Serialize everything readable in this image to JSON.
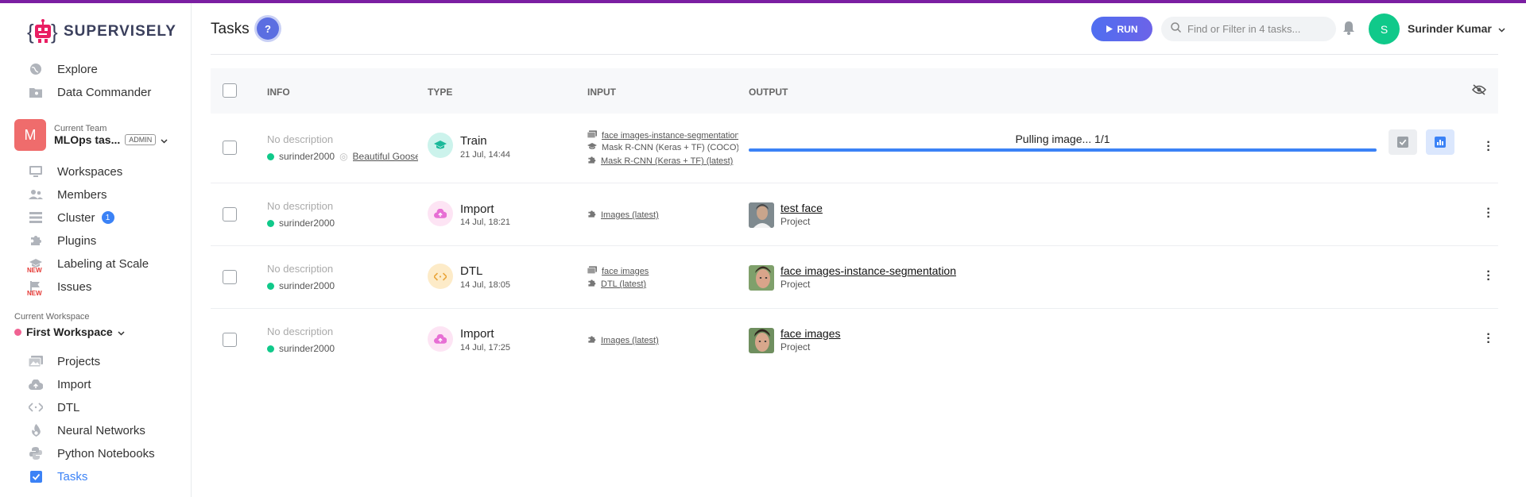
{
  "app": {
    "logo_text": "SUPERVISELY",
    "accent": "#7b1fa2"
  },
  "sidebar": {
    "top_items": [
      {
        "label": "Explore",
        "icon": "globe-icon"
      },
      {
        "label": "Data Commander",
        "icon": "folder-icon"
      }
    ],
    "team": {
      "section_label": "Current Team",
      "avatar_letter": "M",
      "name": "MLOps tas...",
      "role": "ADMIN"
    },
    "team_items": [
      {
        "label": "Workspaces",
        "icon": "monitor-icon"
      },
      {
        "label": "Members",
        "icon": "members-icon"
      },
      {
        "label": "Cluster",
        "icon": "cluster-icon",
        "badge": "1"
      },
      {
        "label": "Plugins",
        "icon": "puzzle-icon"
      },
      {
        "label": "Labeling at Scale",
        "icon": "graduation-cap-icon",
        "new": "NEW"
      },
      {
        "label": "Issues",
        "icon": "flag-icon",
        "new": "NEW"
      }
    ],
    "workspace": {
      "section_label": "Current Workspace",
      "name": "First Workspace"
    },
    "workspace_items": [
      {
        "label": "Projects",
        "icon": "images-icon"
      },
      {
        "label": "Import",
        "icon": "cloud-upload-icon"
      },
      {
        "label": "DTL",
        "icon": "code-arrows-icon"
      },
      {
        "label": "Neural Networks",
        "icon": "fire-icon"
      },
      {
        "label": "Python Notebooks",
        "icon": "python-icon"
      },
      {
        "label": "Tasks",
        "icon": "checkbox-icon",
        "active": true
      }
    ]
  },
  "header": {
    "title": "Tasks",
    "help": "?",
    "run_label": "RUN",
    "search_placeholder": "Find or Filter in 4 tasks...",
    "user_initial": "S",
    "user_name": "Surinder Kumar"
  },
  "table": {
    "columns": {
      "info": "INFO",
      "type": "TYPE",
      "input": "INPUT",
      "output": "OUTPUT"
    },
    "rows": [
      {
        "description": "No description",
        "owner": "surinder2000",
        "session": "Beautiful Goose",
        "type": "Train",
        "date": "21 Jul, 14:44",
        "inputs": [
          {
            "icon": "images-icon",
            "text": "face images-instance-segmentation",
            "link": true
          },
          {
            "icon": "graduation-cap-icon",
            "text": "Mask R-CNN (Keras + TF) (COCO)",
            "link": false
          },
          {
            "icon": "puzzle-icon",
            "text": "Mask R-CNN (Keras + TF) (latest)",
            "link": true
          }
        ],
        "progress_text": "Pulling image... 1/1",
        "progress": 1.0
      },
      {
        "description": "No description",
        "owner": "surinder2000",
        "type": "Import",
        "date": "14 Jul, 18:21",
        "inputs": [
          {
            "icon": "puzzle-icon",
            "text": "Images (latest)",
            "link": true
          }
        ],
        "output_name": "test face",
        "output_sub": "Project"
      },
      {
        "description": "No description",
        "owner": "surinder2000",
        "type": "DTL",
        "date": "14 Jul, 18:05",
        "inputs": [
          {
            "icon": "images-icon",
            "text": "face images",
            "link": true
          },
          {
            "icon": "puzzle-icon",
            "text": "DTL (latest)",
            "link": true
          }
        ],
        "output_name": "face images-instance-segmentation",
        "output_sub": "Project"
      },
      {
        "description": "No description",
        "owner": "surinder2000",
        "type": "Import",
        "date": "14 Jul, 17:25",
        "inputs": [
          {
            "icon": "puzzle-icon",
            "text": "Images (latest)",
            "link": true
          }
        ],
        "output_name": "face images",
        "output_sub": "Project"
      }
    ]
  }
}
